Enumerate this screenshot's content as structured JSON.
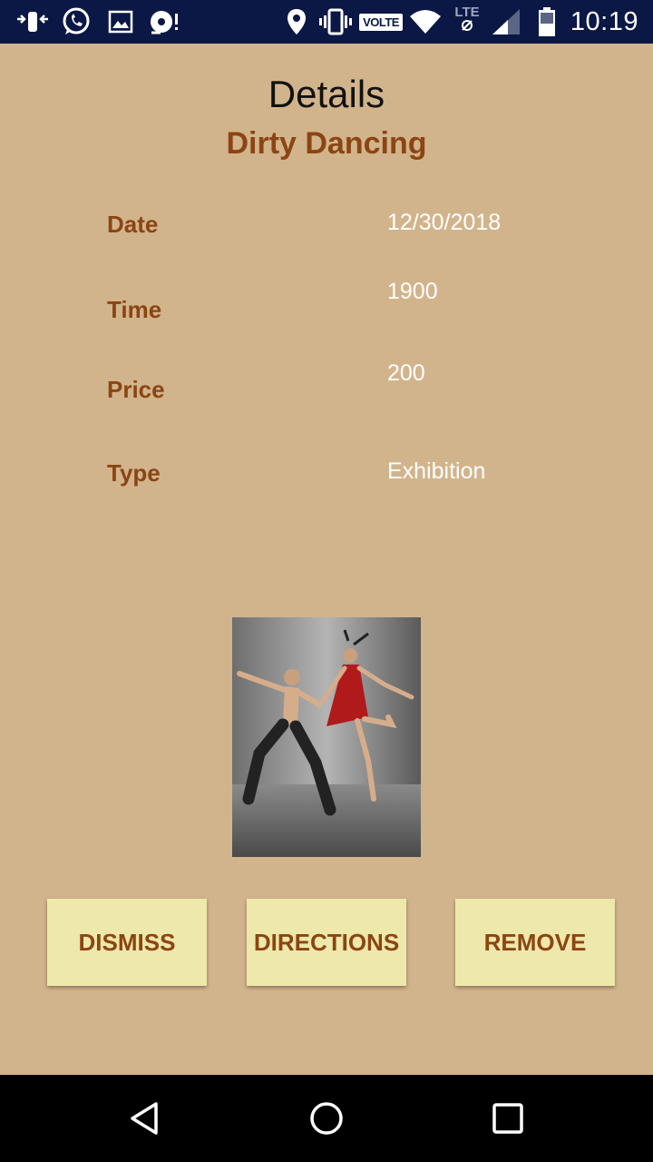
{
  "status_bar": {
    "time": "10:19",
    "volte_label": "VOLTE",
    "lte_label": "LTE",
    "battery_level": "40",
    "icons": [
      "notification-arrows-icon",
      "whatsapp-icon",
      "gallery-icon",
      "media-icon",
      "location-icon",
      "vibrate-icon",
      "volte-icon",
      "wifi-icon",
      "lte-icon",
      "signal-icon",
      "battery-icon"
    ]
  },
  "header": {
    "title": "Details",
    "event_name": "Dirty Dancing"
  },
  "details": {
    "date_label": "Date",
    "date_value": "12/30/2018",
    "time_label": "Time",
    "time_value": "1900",
    "price_label": "Price",
    "price_value": "200",
    "type_label": "Type",
    "type_value": "Exhibition"
  },
  "actions": {
    "dismiss": "DISMISS",
    "directions": "DIRECTIONS",
    "remove": "REMOVE"
  },
  "nav": {
    "icons": [
      "back-icon",
      "home-icon",
      "recents-icon"
    ]
  },
  "colors": {
    "background": "#D2B48C",
    "accent": "#8B4513",
    "button_bg": "#EEE8AA",
    "status_bar": "#0B1845"
  }
}
